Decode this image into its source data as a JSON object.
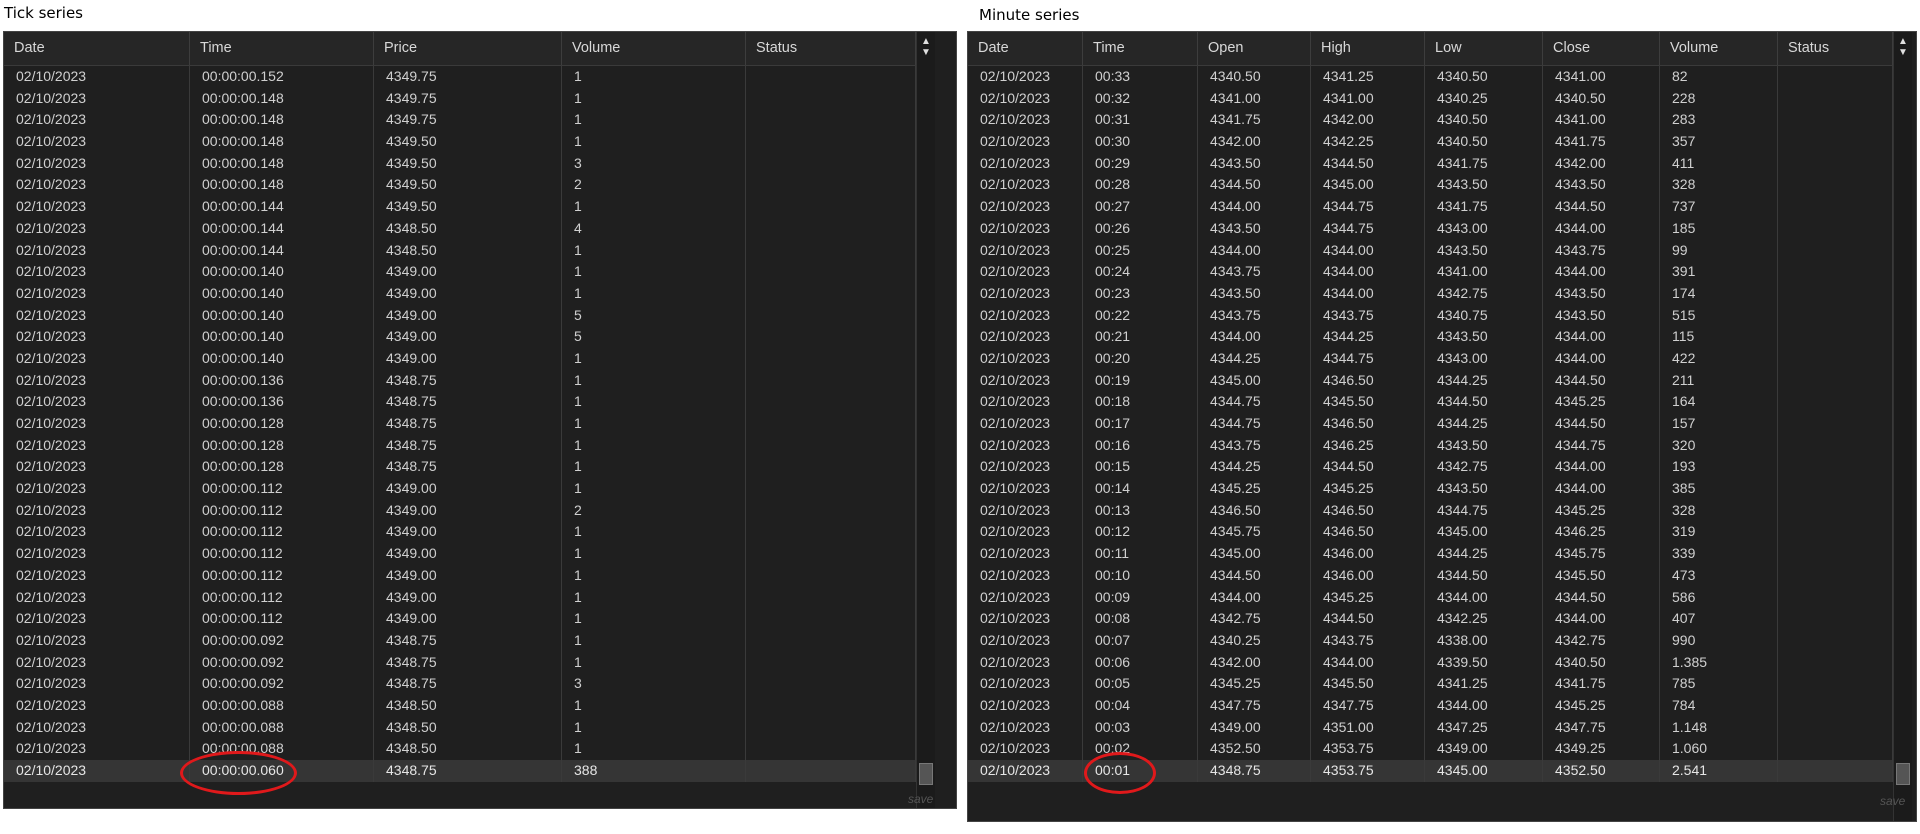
{
  "tick": {
    "caption": "Tick series",
    "headers": [
      "Date",
      "Time",
      "Price",
      "Volume",
      "Status"
    ],
    "rows": [
      [
        "02/10/2023",
        "00:00:00.152",
        "4349.75",
        "1",
        ""
      ],
      [
        "02/10/2023",
        "00:00:00.148",
        "4349.75",
        "1",
        ""
      ],
      [
        "02/10/2023",
        "00:00:00.148",
        "4349.75",
        "1",
        ""
      ],
      [
        "02/10/2023",
        "00:00:00.148",
        "4349.50",
        "1",
        ""
      ],
      [
        "02/10/2023",
        "00:00:00.148",
        "4349.50",
        "3",
        ""
      ],
      [
        "02/10/2023",
        "00:00:00.148",
        "4349.50",
        "2",
        ""
      ],
      [
        "02/10/2023",
        "00:00:00.144",
        "4349.50",
        "1",
        ""
      ],
      [
        "02/10/2023",
        "00:00:00.144",
        "4348.50",
        "4",
        ""
      ],
      [
        "02/10/2023",
        "00:00:00.144",
        "4348.50",
        "1",
        ""
      ],
      [
        "02/10/2023",
        "00:00:00.140",
        "4349.00",
        "1",
        ""
      ],
      [
        "02/10/2023",
        "00:00:00.140",
        "4349.00",
        "1",
        ""
      ],
      [
        "02/10/2023",
        "00:00:00.140",
        "4349.00",
        "5",
        ""
      ],
      [
        "02/10/2023",
        "00:00:00.140",
        "4349.00",
        "5",
        ""
      ],
      [
        "02/10/2023",
        "00:00:00.140",
        "4349.00",
        "1",
        ""
      ],
      [
        "02/10/2023",
        "00:00:00.136",
        "4348.75",
        "1",
        ""
      ],
      [
        "02/10/2023",
        "00:00:00.136",
        "4348.75",
        "1",
        ""
      ],
      [
        "02/10/2023",
        "00:00:00.128",
        "4348.75",
        "1",
        ""
      ],
      [
        "02/10/2023",
        "00:00:00.128",
        "4348.75",
        "1",
        ""
      ],
      [
        "02/10/2023",
        "00:00:00.128",
        "4348.75",
        "1",
        ""
      ],
      [
        "02/10/2023",
        "00:00:00.112",
        "4349.00",
        "1",
        ""
      ],
      [
        "02/10/2023",
        "00:00:00.112",
        "4349.00",
        "2",
        ""
      ],
      [
        "02/10/2023",
        "00:00:00.112",
        "4349.00",
        "1",
        ""
      ],
      [
        "02/10/2023",
        "00:00:00.112",
        "4349.00",
        "1",
        ""
      ],
      [
        "02/10/2023",
        "00:00:00.112",
        "4349.00",
        "1",
        ""
      ],
      [
        "02/10/2023",
        "00:00:00.112",
        "4349.00",
        "1",
        ""
      ],
      [
        "02/10/2023",
        "00:00:00.112",
        "4349.00",
        "1",
        ""
      ],
      [
        "02/10/2023",
        "00:00:00.092",
        "4348.75",
        "1",
        ""
      ],
      [
        "02/10/2023",
        "00:00:00.092",
        "4348.75",
        "1",
        ""
      ],
      [
        "02/10/2023",
        "00:00:00.092",
        "4348.75",
        "3",
        ""
      ],
      [
        "02/10/2023",
        "00:00:00.088",
        "4348.50",
        "1",
        ""
      ],
      [
        "02/10/2023",
        "00:00:00.088",
        "4348.50",
        "1",
        ""
      ],
      [
        "02/10/2023",
        "00:00:00.088",
        "4348.50",
        "1",
        ""
      ],
      [
        "02/10/2023",
        "00:00:00.060",
        "4348.75",
        "388",
        ""
      ]
    ],
    "save_label": "save"
  },
  "minute": {
    "caption": "Minute series",
    "headers": [
      "Date",
      "Time",
      "Open",
      "High",
      "Low",
      "Close",
      "Volume",
      "Status"
    ],
    "rows": [
      [
        "02/10/2023",
        "00:33",
        "4340.50",
        "4341.25",
        "4340.50",
        "4341.00",
        "82",
        ""
      ],
      [
        "02/10/2023",
        "00:32",
        "4341.00",
        "4341.00",
        "4340.25",
        "4340.50",
        "228",
        ""
      ],
      [
        "02/10/2023",
        "00:31",
        "4341.75",
        "4342.00",
        "4340.50",
        "4341.00",
        "283",
        ""
      ],
      [
        "02/10/2023",
        "00:30",
        "4342.00",
        "4342.25",
        "4340.50",
        "4341.75",
        "357",
        ""
      ],
      [
        "02/10/2023",
        "00:29",
        "4343.50",
        "4344.50",
        "4341.75",
        "4342.00",
        "411",
        ""
      ],
      [
        "02/10/2023",
        "00:28",
        "4344.50",
        "4345.00",
        "4343.50",
        "4343.50",
        "328",
        ""
      ],
      [
        "02/10/2023",
        "00:27",
        "4344.00",
        "4344.75",
        "4341.75",
        "4344.50",
        "737",
        ""
      ],
      [
        "02/10/2023",
        "00:26",
        "4343.50",
        "4344.75",
        "4343.00",
        "4344.00",
        "185",
        ""
      ],
      [
        "02/10/2023",
        "00:25",
        "4344.00",
        "4344.00",
        "4343.50",
        "4343.75",
        "99",
        ""
      ],
      [
        "02/10/2023",
        "00:24",
        "4343.75",
        "4344.00",
        "4341.00",
        "4344.00",
        "391",
        ""
      ],
      [
        "02/10/2023",
        "00:23",
        "4343.50",
        "4344.00",
        "4342.75",
        "4343.50",
        "174",
        ""
      ],
      [
        "02/10/2023",
        "00:22",
        "4343.75",
        "4343.75",
        "4340.75",
        "4343.50",
        "515",
        ""
      ],
      [
        "02/10/2023",
        "00:21",
        "4344.00",
        "4344.25",
        "4343.50",
        "4344.00",
        "115",
        ""
      ],
      [
        "02/10/2023",
        "00:20",
        "4344.25",
        "4344.75",
        "4343.00",
        "4344.00",
        "422",
        ""
      ],
      [
        "02/10/2023",
        "00:19",
        "4345.00",
        "4346.50",
        "4344.25",
        "4344.50",
        "211",
        ""
      ],
      [
        "02/10/2023",
        "00:18",
        "4344.75",
        "4345.50",
        "4344.50",
        "4345.25",
        "164",
        ""
      ],
      [
        "02/10/2023",
        "00:17",
        "4344.75",
        "4346.50",
        "4344.25",
        "4344.50",
        "157",
        ""
      ],
      [
        "02/10/2023",
        "00:16",
        "4343.75",
        "4346.25",
        "4343.50",
        "4344.75",
        "320",
        ""
      ],
      [
        "02/10/2023",
        "00:15",
        "4344.25",
        "4344.50",
        "4342.75",
        "4344.00",
        "193",
        ""
      ],
      [
        "02/10/2023",
        "00:14",
        "4345.25",
        "4345.25",
        "4343.50",
        "4344.00",
        "385",
        ""
      ],
      [
        "02/10/2023",
        "00:13",
        "4346.50",
        "4346.50",
        "4344.75",
        "4345.25",
        "328",
        ""
      ],
      [
        "02/10/2023",
        "00:12",
        "4345.75",
        "4346.50",
        "4345.00",
        "4346.25",
        "319",
        ""
      ],
      [
        "02/10/2023",
        "00:11",
        "4345.00",
        "4346.00",
        "4344.25",
        "4345.75",
        "339",
        ""
      ],
      [
        "02/10/2023",
        "00:10",
        "4344.50",
        "4346.00",
        "4344.50",
        "4345.50",
        "473",
        ""
      ],
      [
        "02/10/2023",
        "00:09",
        "4344.00",
        "4345.25",
        "4344.00",
        "4344.50",
        "586",
        ""
      ],
      [
        "02/10/2023",
        "00:08",
        "4342.75",
        "4344.50",
        "4342.25",
        "4344.00",
        "407",
        ""
      ],
      [
        "02/10/2023",
        "00:07",
        "4340.25",
        "4343.75",
        "4338.00",
        "4342.75",
        "990",
        ""
      ],
      [
        "02/10/2023",
        "00:06",
        "4342.00",
        "4344.00",
        "4339.50",
        "4340.50",
        "1.385",
        ""
      ],
      [
        "02/10/2023",
        "00:05",
        "4345.25",
        "4345.50",
        "4341.25",
        "4341.75",
        "785",
        ""
      ],
      [
        "02/10/2023",
        "00:04",
        "4347.75",
        "4347.75",
        "4344.00",
        "4345.25",
        "784",
        ""
      ],
      [
        "02/10/2023",
        "00:03",
        "4349.00",
        "4351.00",
        "4347.25",
        "4347.75",
        "1.148",
        ""
      ],
      [
        "02/10/2023",
        "00:02",
        "4352.50",
        "4353.75",
        "4349.00",
        "4349.25",
        "1.060",
        ""
      ],
      [
        "02/10/2023",
        "00:01",
        "4348.75",
        "4353.75",
        "4345.00",
        "4352.50",
        "2.541",
        ""
      ]
    ],
    "save_label": "save"
  },
  "colors": {
    "panel_bg": "#1f1f1f",
    "highlight_row": "#353535",
    "annotation_circle": "#e0191b"
  }
}
